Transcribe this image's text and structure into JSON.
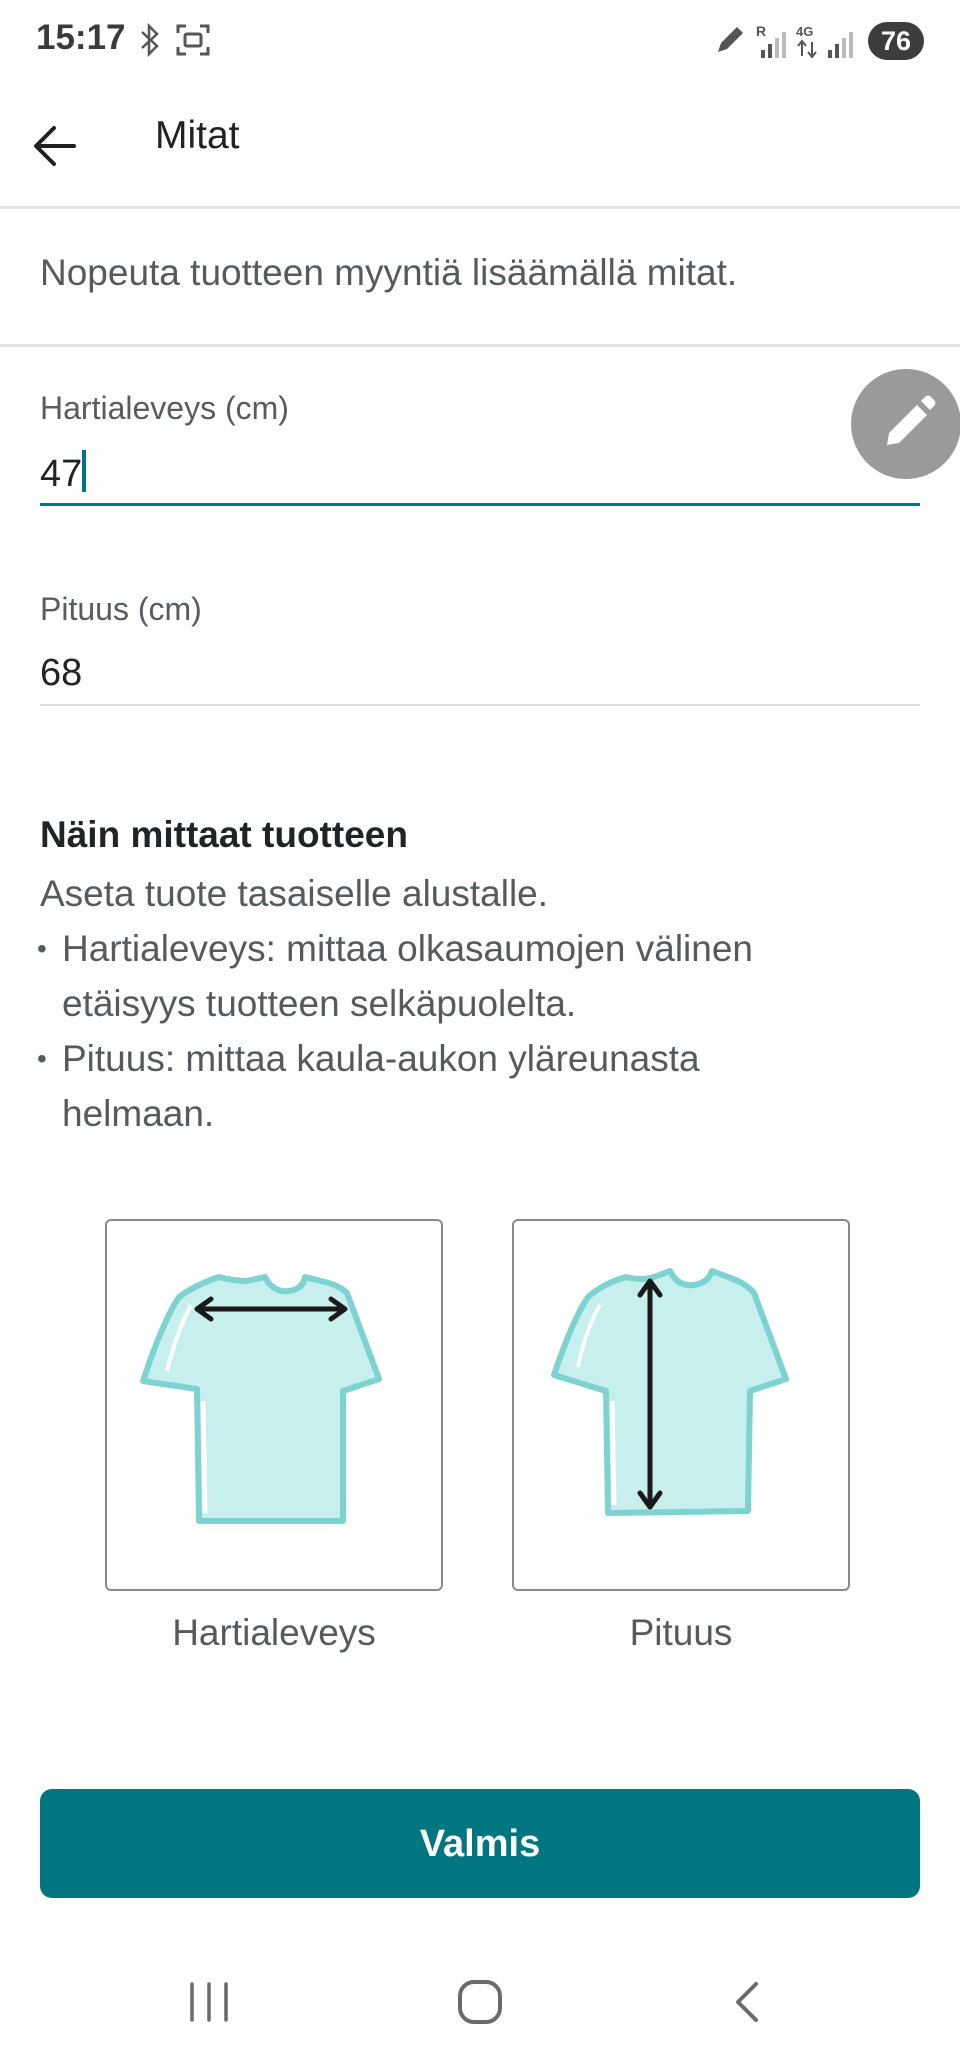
{
  "status_bar": {
    "time": "15:17",
    "battery": "76"
  },
  "header": {
    "title": "Mitat"
  },
  "intro_text": "Nopeuta tuotteen myyntiä lisäämällä mitat.",
  "fields": [
    {
      "label": "Hartialeveys (cm)",
      "value": "47"
    },
    {
      "label": "Pituus (cm)",
      "value": "68"
    }
  ],
  "instructions": {
    "title": "Näin mittaat tuotteen",
    "intro": "Aseta tuote tasaiselle alustalle.",
    "bullet1_line1": "Hartialeveys: mittaa olkasaumojen välinen",
    "bullet1_line2": "etäisyys tuotteen selkäpuolelta.",
    "bullet2_line1": "Pituus: mittaa kaula-aukon yläreunasta",
    "bullet2_line2": "helmaan."
  },
  "illustrations": [
    {
      "caption": "Hartialeveys",
      "icon": "tshirt-shoulder-width-icon"
    },
    {
      "caption": "Pituus",
      "icon": "tshirt-length-icon"
    }
  ],
  "done_button": "Valmis",
  "colors": {
    "accent": "#007681",
    "shirt_fill": "#c7efed",
    "shirt_stroke": "#7dd3d1",
    "fab": "#9a9a9a"
  }
}
